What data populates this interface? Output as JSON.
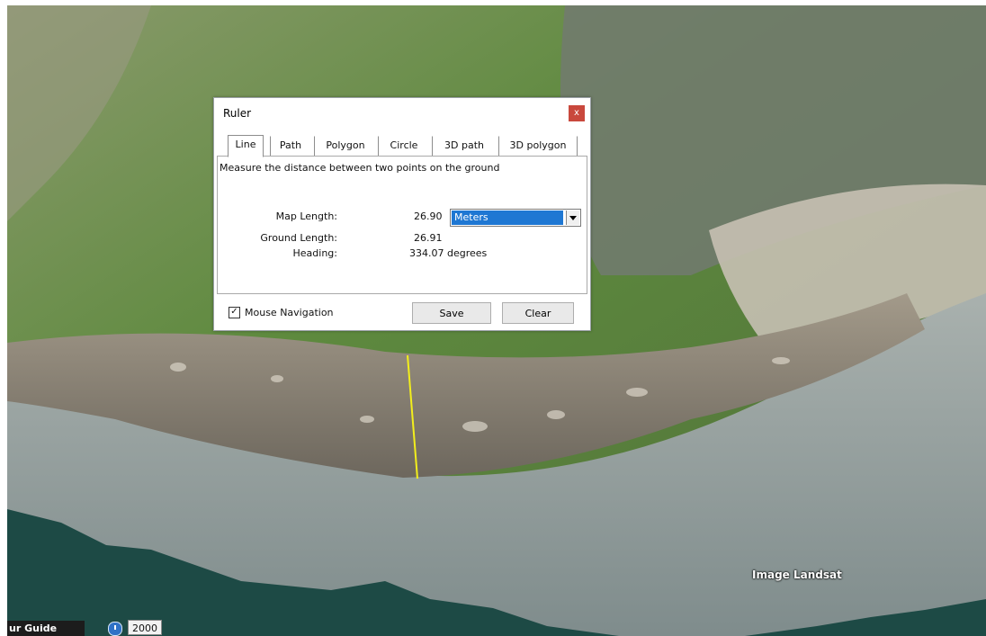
{
  "dialog": {
    "title": "Ruler",
    "close_label": "x",
    "tabs": [
      {
        "label": "Line",
        "active": true
      },
      {
        "label": "Path"
      },
      {
        "label": "Polygon"
      },
      {
        "label": "Circle"
      },
      {
        "label": "3D path"
      },
      {
        "label": "3D polygon"
      }
    ],
    "description": "Measure the distance between two points on the ground",
    "map_length_label": "Map Length:",
    "map_length_value": "26.90",
    "units_selected": "Meters",
    "ground_length_label": "Ground Length:",
    "ground_length_value": "26.91",
    "heading_label": "Heading:",
    "heading_value": "334.07 degrees",
    "mouse_navigation_label": "Mouse Navigation",
    "mouse_navigation_checked": true,
    "check_mark": "✓",
    "save_label": "Save",
    "clear_label": "Clear"
  },
  "statusbar": {
    "guide_label": "ur Guide",
    "year": "2000"
  },
  "map": {
    "attribution": "Image Landsat",
    "ruler_line_color": "#f2ee1c"
  }
}
